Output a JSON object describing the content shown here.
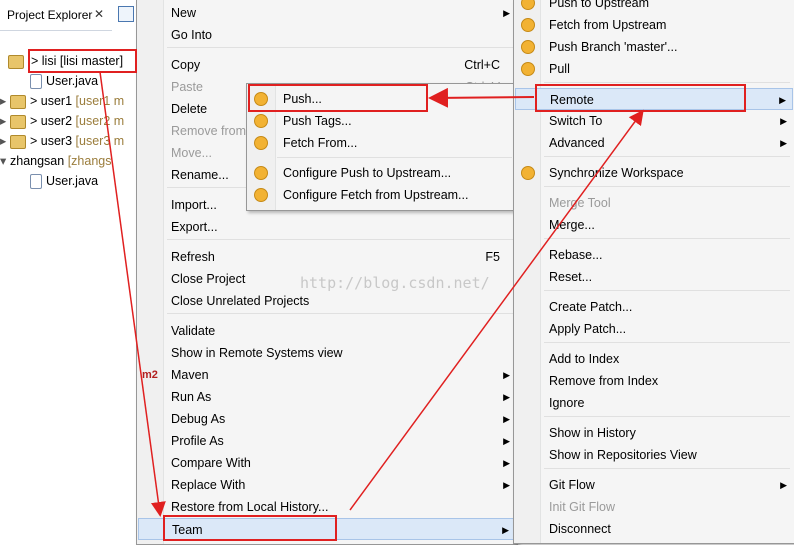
{
  "explorer": {
    "title": "Project Explorer",
    "close": "✕",
    "tree": [
      {
        "prefix": "> ",
        "name": "lisi",
        "branch": "[lisi master]",
        "selected": true
      },
      {
        "prefix": "",
        "name": "User.java",
        "branch": "",
        "file": true
      },
      {
        "prefix": "> ",
        "name": "user1",
        "branch": "[user1 m"
      },
      {
        "prefix": "> ",
        "name": "user2",
        "branch": "[user2 m"
      },
      {
        "prefix": "> ",
        "name": "user3",
        "branch": "[user3 m"
      },
      {
        "prefix": "",
        "name": "zhangsan",
        "branch": "[zhangs"
      },
      {
        "prefix": "",
        "name": "User.java",
        "branch": "",
        "file": true
      }
    ]
  },
  "main_menu": {
    "items": [
      {
        "label": "New",
        "submenu": true
      },
      {
        "label": "Go Into"
      },
      {
        "label": "Copy",
        "shortcut": "Ctrl+C"
      },
      {
        "label": "Paste",
        "shortcut": "Ctrl+V",
        "disabled": true
      },
      {
        "label": "Delete"
      },
      {
        "label": "Remove from",
        "disabled": true
      },
      {
        "label": "Move...",
        "disabled": true
      },
      {
        "label": "Rename..."
      },
      {
        "label": "Import..."
      },
      {
        "label": "Export..."
      },
      {
        "label": "Refresh",
        "shortcut": "F5"
      },
      {
        "label": "Close Project"
      },
      {
        "label": "Close Unrelated Projects"
      },
      {
        "label": "Validate"
      },
      {
        "label": "Show in Remote Systems view"
      },
      {
        "label": "Maven",
        "submenu": true
      },
      {
        "label": "Run As",
        "submenu": true
      },
      {
        "label": "Debug As",
        "submenu": true
      },
      {
        "label": "Profile As",
        "submenu": true
      },
      {
        "label": "Compare With",
        "submenu": true
      },
      {
        "label": "Replace With",
        "submenu": true
      },
      {
        "label": "Restore from Local History..."
      },
      {
        "label": "Team",
        "submenu": true,
        "highlighted": true
      }
    ],
    "maven_icon": "m2"
  },
  "remote_menu": {
    "items": [
      {
        "label": "Push..."
      },
      {
        "label": "Push Tags..."
      },
      {
        "label": "Fetch From..."
      },
      {
        "label": "Configure Push to Upstream..."
      },
      {
        "label": "Configure Fetch from Upstream..."
      }
    ]
  },
  "team_menu": {
    "items": [
      {
        "label": "Push to Upstream"
      },
      {
        "label": "Fetch from Upstream"
      },
      {
        "label": "Push Branch 'master'..."
      },
      {
        "label": "Pull"
      },
      {
        "label": "Remote",
        "submenu": true,
        "highlighted": true
      },
      {
        "label": "Switch To",
        "submenu": true
      },
      {
        "label": "Advanced",
        "submenu": true
      },
      {
        "label": "Synchronize Workspace"
      },
      {
        "label": "Merge Tool",
        "disabled": true
      },
      {
        "label": "Merge..."
      },
      {
        "label": "Rebase..."
      },
      {
        "label": "Reset..."
      },
      {
        "label": "Create Patch..."
      },
      {
        "label": "Apply Patch..."
      },
      {
        "label": "Add to Index"
      },
      {
        "label": "Remove from Index"
      },
      {
        "label": "Ignore"
      },
      {
        "label": "Show in History"
      },
      {
        "label": "Show in Repositories View"
      },
      {
        "label": "Git Flow",
        "submenu": true
      },
      {
        "label": "Init Git Flow",
        "disabled": true
      },
      {
        "label": "Disconnect"
      }
    ]
  },
  "watermark": "http://blog.csdn.net/",
  "annotation_color": "#e02020"
}
